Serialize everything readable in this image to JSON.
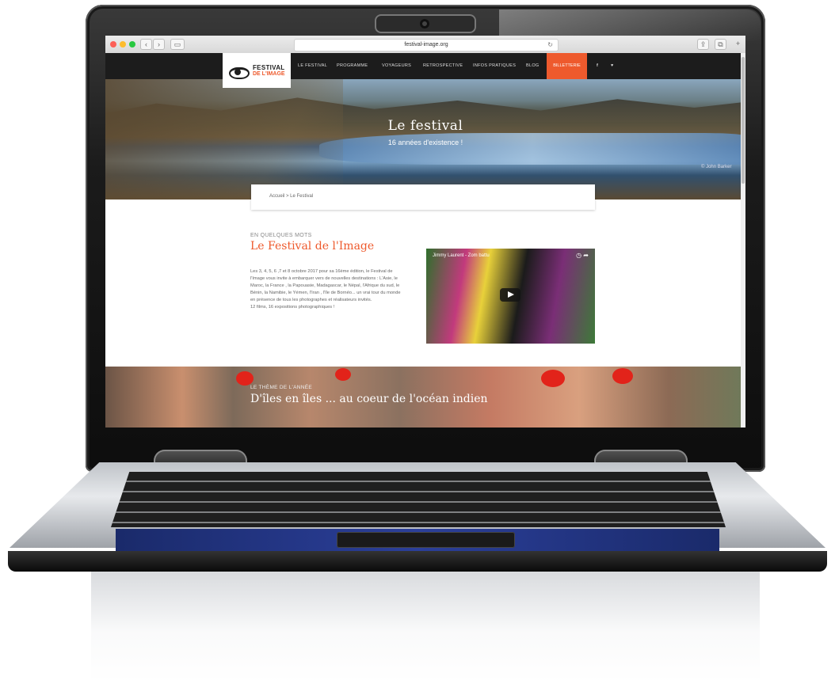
{
  "browser": {
    "url": "festival-image.org",
    "back_icon": "chevron-left-icon",
    "forward_icon": "chevron-right-icon",
    "sidebar_icon": "sidebar-icon",
    "share_icon": "share-icon",
    "tabs_icon": "tabs-icon",
    "new_tab_icon": "plus-icon",
    "reload_icon": "reload-icon"
  },
  "site": {
    "logo": {
      "line1": "FESTIVAL",
      "line2": "DE L'IMAGE"
    },
    "nav": [
      "LE FESTIVAL",
      "PROGRAMME",
      "VOYAGEURS",
      "RETROSPECTIVE",
      "INFOS PRATIQUES",
      "BLOG"
    ],
    "cta": "BILLETTERIE",
    "social": [
      "f",
      "♥"
    ]
  },
  "hero": {
    "title": "Le festival",
    "subtitle": "16 années d'existence !",
    "credit": "© John Barker"
  },
  "breadcrumb": "Accueil > Le Festival",
  "section": {
    "kicker": "EN QUELQUES MOTS",
    "title": "Le Festival de l'Image",
    "body": "Les 3, 4, 5, 6 ,7 et 8 octobre 2017 pour sa 16ème édition, le Festival de l'Image vous invite à embarquer vers de nouvelles destinations : L'Asie, le Maroc, la France , la Papouasie, Madagascar, le Népal, l'Afrique du sud, le Bénin, la Namibie, le Yémen, l'Iran , l'île de Bornéo... un vrai tour du monde en présence de tous les photographes et réalisateurs invités.",
    "body2": "12 films, 16 expositions photographiques !"
  },
  "video": {
    "title": "Jimmy Laurent - Zom battu",
    "play_icon": "play-icon"
  },
  "theme": {
    "kicker": "LE THÈME DE L'ANNÉE",
    "title": "D'îles en îles ... au coeur de l'océan indien"
  },
  "colors": {
    "accent": "#ee5a2d",
    "nav_bg": "#1c1c1c"
  }
}
